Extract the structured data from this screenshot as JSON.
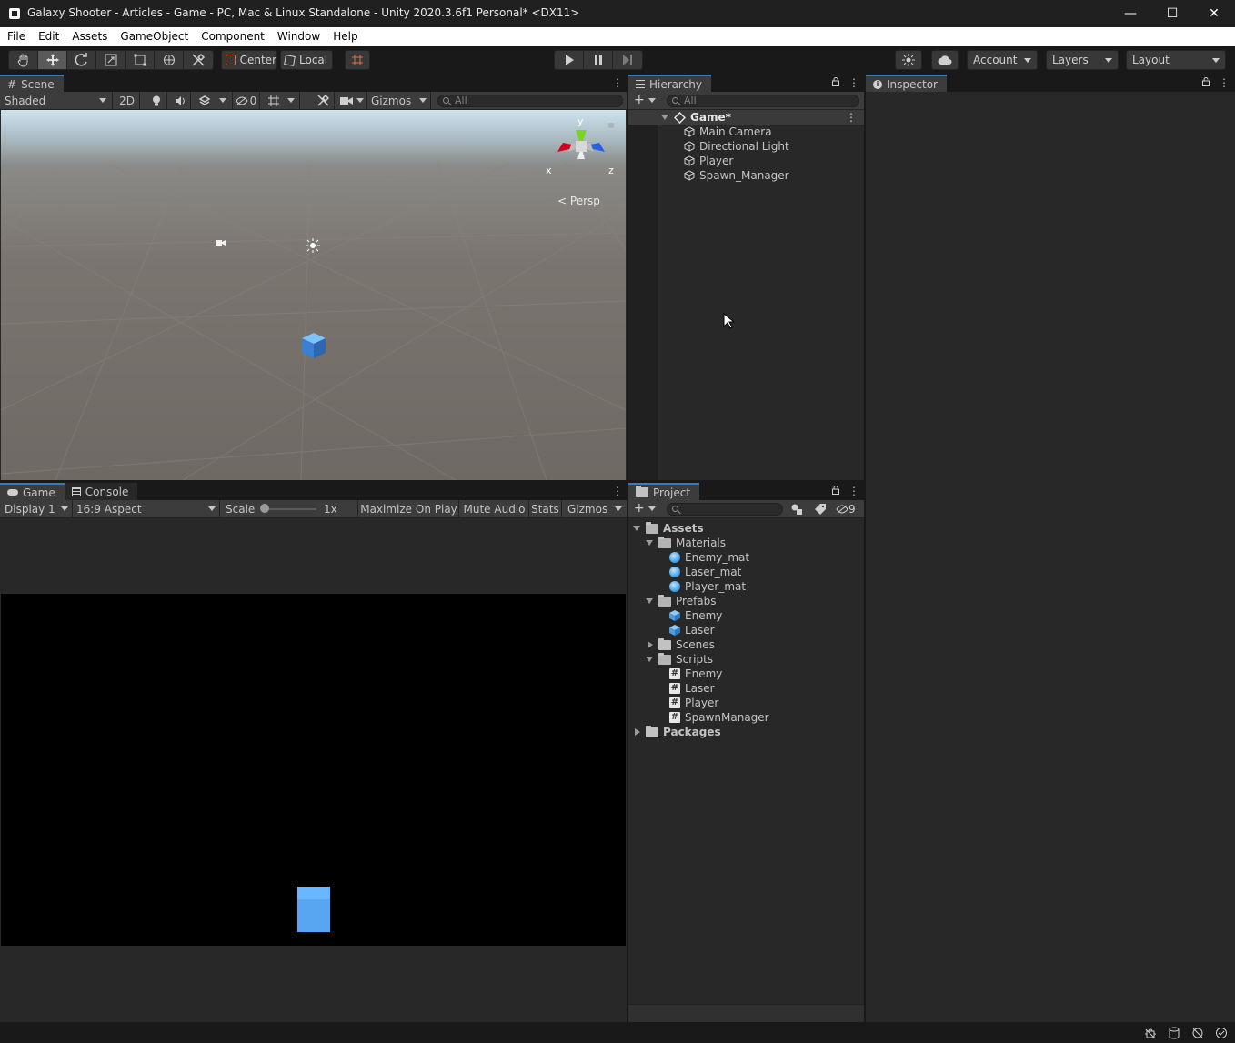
{
  "window": {
    "title": "Galaxy Shooter - Articles - Game - PC, Mac & Linux Standalone - Unity 2020.3.6f1 Personal* <DX11>",
    "controls": {
      "minimize": "—",
      "maximize": "☐",
      "close": "✕"
    }
  },
  "menu": [
    "File",
    "Edit",
    "Assets",
    "GameObject",
    "Component",
    "Window",
    "Help"
  ],
  "toolbar": {
    "pivot_label": "Center",
    "space_label": "Local",
    "account_label": "Account",
    "layers_label": "Layers",
    "layout_label": "Layout"
  },
  "scene": {
    "tab_label": "Scene",
    "shading_mode": "Shaded",
    "mode_2d_label": "2D",
    "hidden_count": "0",
    "gizmos_label": "Gizmos",
    "search_placeholder": "All",
    "persp_label": "Persp",
    "axis_y": "y",
    "axis_x": "x",
    "axis_z": "z"
  },
  "game": {
    "tab_label": "Game",
    "console_tab_label": "Console",
    "display_label": "Display 1",
    "aspect_label": "16:9 Aspect",
    "scale_label": "Scale",
    "scale_value": "1x",
    "maximize_label": "Maximize On Play",
    "mute_label": "Mute Audio",
    "stats_label": "Stats",
    "gizmos_label": "Gizmos"
  },
  "hierarchy": {
    "tab_label": "Hierarchy",
    "search_placeholder": "All",
    "scene_name": "Game*",
    "items": [
      "Main Camera",
      "Directional Light",
      "Player",
      "Spawn_Manager"
    ]
  },
  "inspector": {
    "tab_label": "Inspector"
  },
  "project": {
    "tab_label": "Project",
    "hidden_count": "9",
    "tree": {
      "assets_label": "Assets",
      "materials_label": "Materials",
      "materials": [
        "Enemy_mat",
        "Laser_mat",
        "Player_mat"
      ],
      "prefabs_label": "Prefabs",
      "prefabs": [
        "Enemy",
        "Laser"
      ],
      "scenes_label": "Scenes",
      "scripts_label": "Scripts",
      "scripts": [
        "Enemy",
        "Laser",
        "Player",
        "SpawnManager"
      ],
      "packages_label": "Packages"
    }
  },
  "icons": {
    "script_glyph": "#",
    "kebab": "⋮"
  }
}
